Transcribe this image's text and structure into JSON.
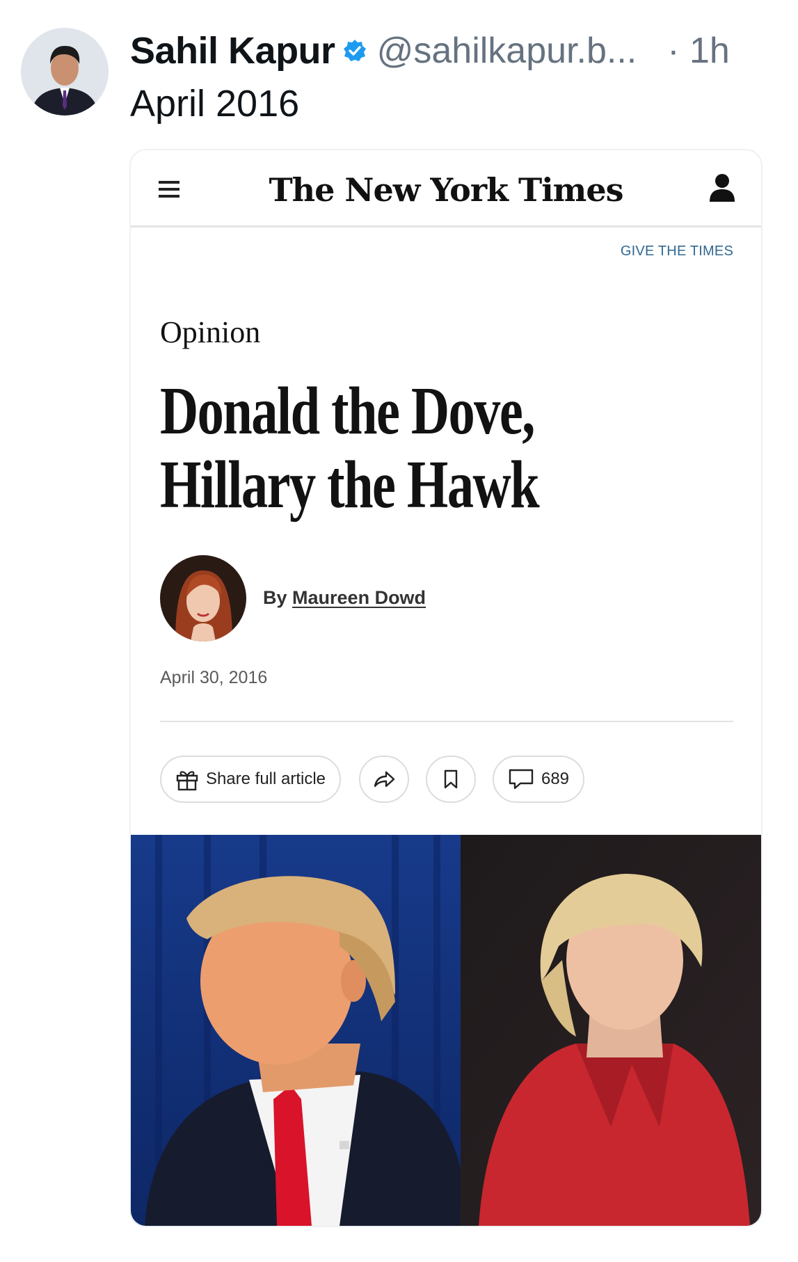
{
  "post": {
    "author_name": "Sahil Kapur",
    "handle": "@sahilkapur.b...",
    "time": "· 1h",
    "text": "April 2016",
    "avatar_icon": "profile-photo",
    "verified_icon": "verified-badge-icon",
    "verified_color": "#1d9bf0"
  },
  "article": {
    "masthead": "The New York Times",
    "give_link": "GIVE THE TIMES",
    "section": "Opinion",
    "headline_line1": "Donald the Dove,",
    "headline_line2": "Hillary the Hawk",
    "byline_prefix": "By",
    "author": "Maureen Dowd",
    "date": "April 30, 2016",
    "actions": {
      "share_label": "Share full article",
      "comment_count": "689"
    },
    "icons": [
      "menu-icon",
      "user-icon",
      "gift-icon",
      "forward-arrow-icon",
      "bookmark-icon",
      "comment-icon"
    ],
    "link_color": "#326891"
  }
}
